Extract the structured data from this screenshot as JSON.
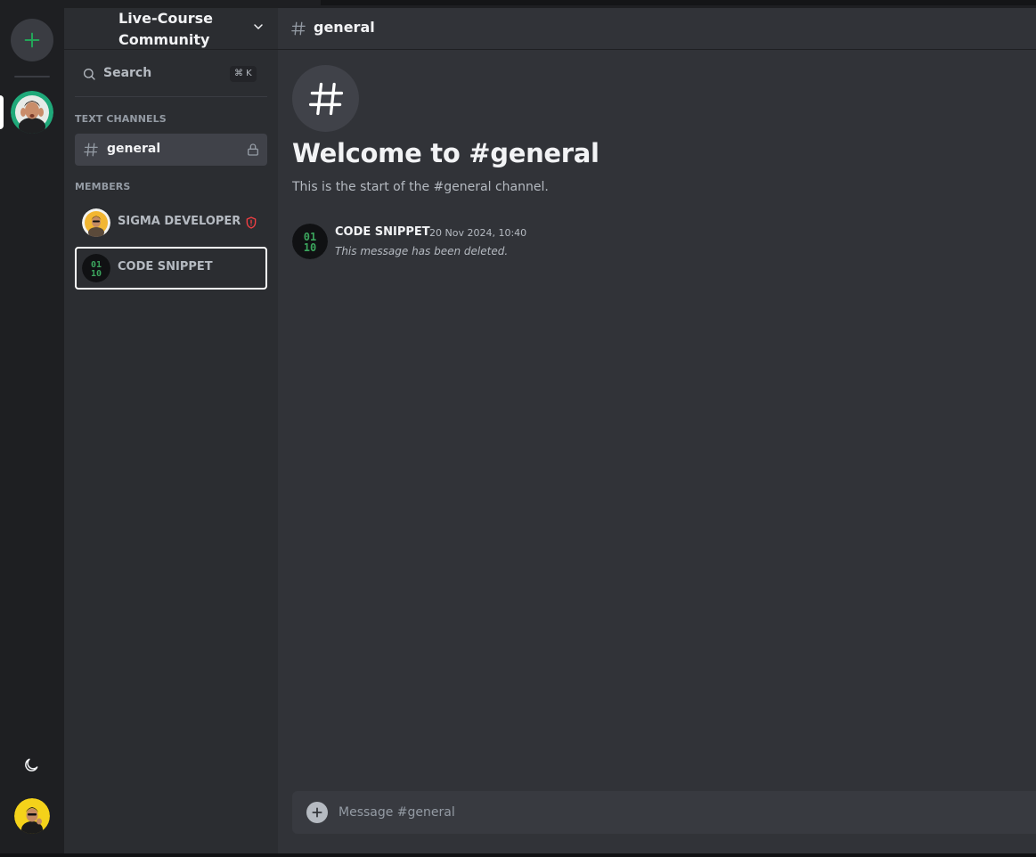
{
  "colors": {
    "accent_green": "#23a559",
    "danger_red": "#f23f43",
    "code_green": "#3ba55d",
    "selected_border": "#ffffff"
  },
  "rail": {
    "add_server_icon": "plus-icon",
    "theme_icon": "moon-icon"
  },
  "server": {
    "name": "Live-Course Community",
    "dropdown_icon": "chevron-down-icon"
  },
  "search": {
    "label": "Search",
    "shortcut": "⌘ K"
  },
  "sections": {
    "text_channels": "TEXT CHANNELS",
    "members": "MEMBERS"
  },
  "channels": [
    {
      "name": "general",
      "icon": "hash-icon",
      "lock_icon": "lock-icon"
    }
  ],
  "members": [
    {
      "name": "SIGMA DEVELOPER",
      "badge_icon": "shield-alert-icon"
    },
    {
      "name": "CODE SNIPPET"
    }
  ],
  "chat": {
    "channel_name": "general",
    "welcome_title": "Welcome to #general",
    "welcome_subtitle": "This is the start of the #general channel."
  },
  "messages": [
    {
      "author": "CODE SNIPPET",
      "timestamp": "20 Nov 2024, 10:40",
      "content": "This message has been deleted."
    }
  ],
  "composer": {
    "placeholder": "Message #general"
  }
}
